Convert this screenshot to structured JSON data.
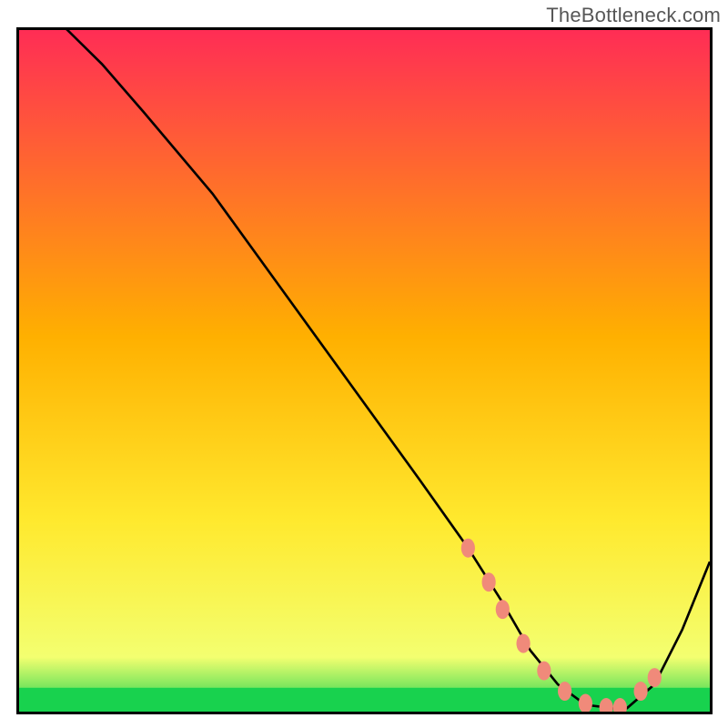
{
  "watermark": "TheBottleneck.com",
  "chart_data": {
    "type": "line",
    "title": "",
    "xlabel": "",
    "ylabel": "",
    "xlim": [
      0,
      100
    ],
    "ylim": [
      0,
      100
    ],
    "grid": false,
    "gradient_colors": {
      "top": "#ff2d55",
      "mid": "#ffd400",
      "low_band": "#f3ff70",
      "green": "#18d24e"
    },
    "curve": {
      "x": [
        0,
        4,
        8,
        12,
        18,
        28,
        38,
        48,
        58,
        65,
        70,
        74,
        78,
        82,
        86,
        88,
        92,
        96,
        100
      ],
      "y": [
        103,
        103,
        99,
        95,
        88,
        76,
        62,
        48,
        34,
        24,
        16,
        9,
        4,
        1,
        0.5,
        0.5,
        4,
        12,
        22
      ]
    },
    "markers": {
      "x": [
        65,
        68,
        70,
        73,
        76,
        79,
        82,
        85,
        87,
        90,
        92
      ],
      "y": [
        24,
        19,
        15,
        10,
        6,
        3,
        1.2,
        0.6,
        0.6,
        3,
        5
      ],
      "color": "#f08a7a"
    }
  }
}
